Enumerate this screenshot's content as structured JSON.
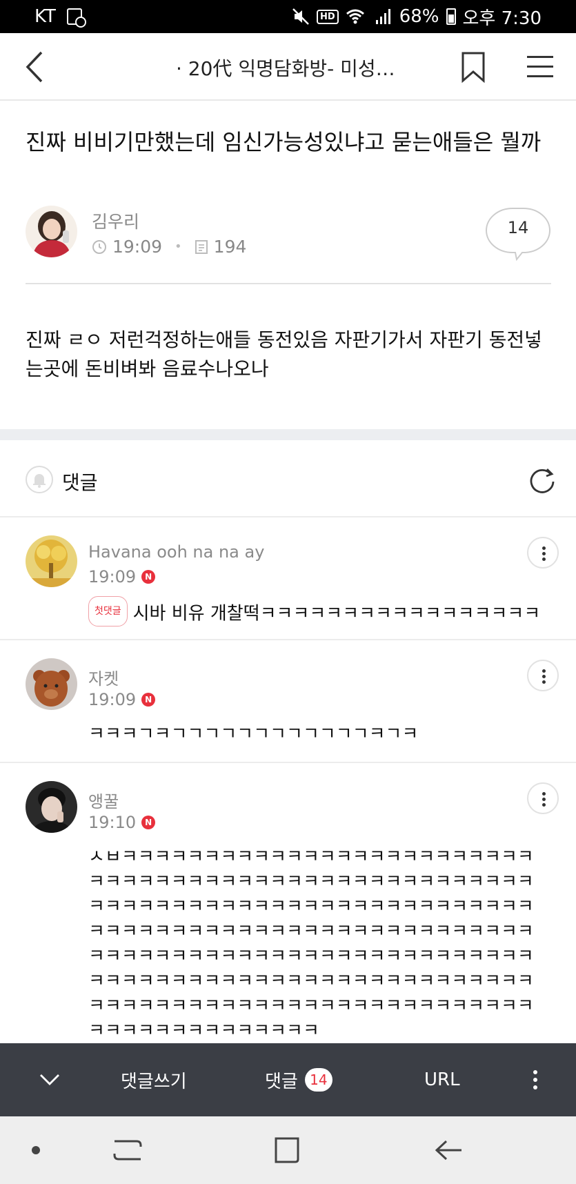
{
  "status_bar": {
    "carrier": "KT",
    "hd": "HD",
    "wifi_label": "G",
    "battery": "68%",
    "time": "오후 7:30"
  },
  "header": {
    "title": "· 20代 익명담화방- 미성…"
  },
  "post": {
    "title": "진짜 비비기만했는데 임신가능성있냐고 묻는애들은 뭘까",
    "author": "김우리",
    "time": "19:09",
    "views": "194",
    "comment_count": "14",
    "body": "진짜 ㄹㅇ 저런걱정하는애들 동전있음 자판기가서 자판기 동전넣는곳에 돈비벼봐 음료수나오나"
  },
  "comments_section": {
    "label": "댓글"
  },
  "comments": [
    {
      "name": "Havana ooh na na ay",
      "time": "19:09",
      "new_badge": "N",
      "first_badge": "첫댓글",
      "text": "시바 비유 개찰떡ㅋㅋㅋㅋㅋㅋㅋㅋㅋㅋㅋㅋㅋㅋㅋㅋㅋ"
    },
    {
      "name": "자켓",
      "time": "19:09",
      "new_badge": "N",
      "text": "ㅋㅋㅋㄱㅋㄱㄱㄱㄱㄱㄱㄱㄱㄱㄱㄱㄱㅋㄱㅋ"
    },
    {
      "name": "앵꿀",
      "time": "19:10",
      "new_badge": "N",
      "text": "ㅅㅂㅋㅋㅋㅋㅋㅋㅋㅋㅋㅋㅋㅋㅋㅋㅋㅋㅋㅋㅋㅋㅋㅋㅋㅋㅋㅋㅋㅋㅋㅋㅋㅋㅋㅋㅋㅋㅋㅋㅋㅋㅋㅋㅋㅋㅋㅋㅋㅋㅋㅋㅋㅋㅋㅋㅋㅋㅋㅋㅋㅋㅋㅋㅋㅋㅋㅋㅋㅋㅋㅋㅋㅋㅋㅋㅋㅋㅋㅋㅋㅋㅋㅋㅋㅋㅋㅋㅋㅋㅋㅋㅋㅋㅋㅋㅋㅋㅋㅋㅋㅋㅋㅋㅋㅋㅋㅋㅋㅋㅋㅋㅋㅋㅋㅋㅋㅋㅋㅋㅋㅋㅋㅋㅋㅋㅋㅋㅋㅋㅋㅋㅋㅋㅋㅋㅋㅋㅋㅋㅋㅋㅋㅋㅋㅋㅋㅋㅋㅋㅋㅋㅋㅋㅋㅋㅋㅋㅋㅋㅋㅋㅋㅋㅋㅋㅋㅋㅋㅋㅋㅋㅋㅋㅋㅋㅋㅋㅋㅋㅋㅋㅋㅋㅋㅋㅋㅋㅋㅋㅋㅋㅋㅋㅋㅋㅋㅋㅋㅋㅋㅋㅋ"
    }
  ],
  "action_bar": {
    "write_label": "댓글쓰기",
    "comments_label": "댓글",
    "comments_count": "14",
    "url_label": "URL"
  },
  "icons": {
    "back": "chevron-left-icon",
    "bookmark": "bookmark-icon",
    "menu": "hamburger-menu-icon",
    "refresh": "refresh-icon",
    "bell": "bell-icon",
    "more": "more-vertical-icon"
  },
  "colors": {
    "accent_red": "#e8303c",
    "action_bar_bg": "#3b3e45"
  }
}
